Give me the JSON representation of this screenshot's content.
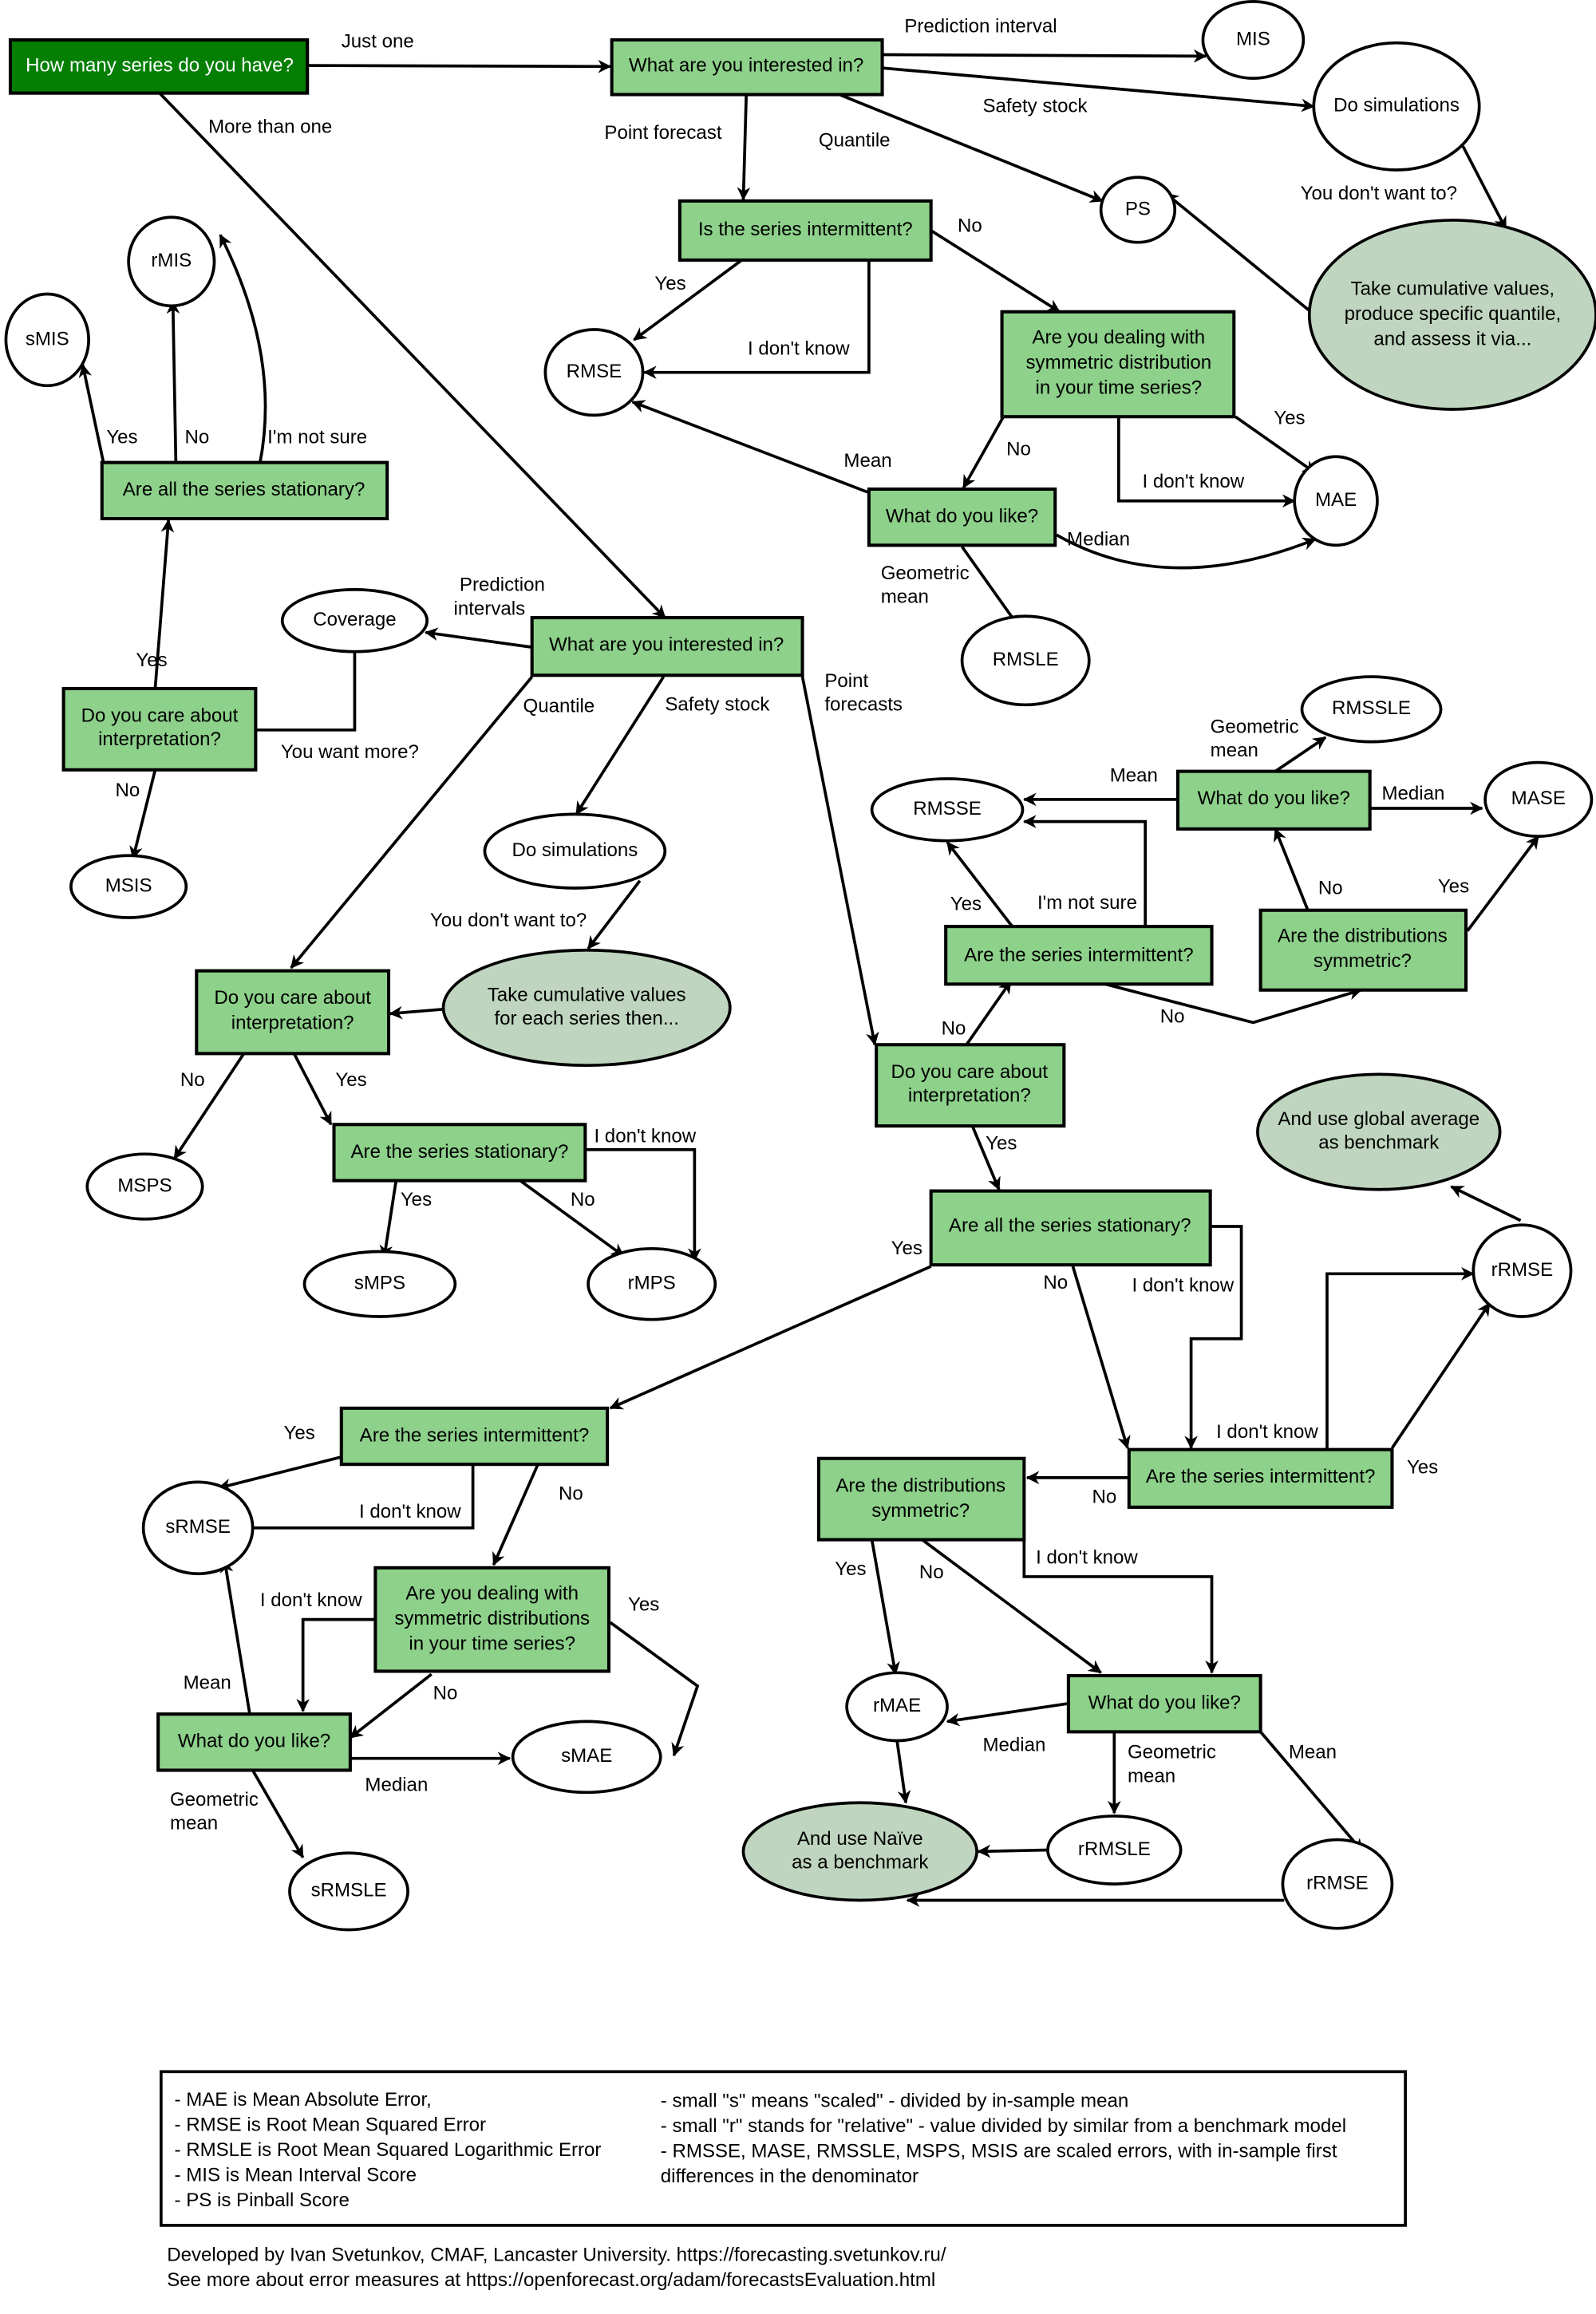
{
  "nodes": {
    "q_how_many": "How many series do you have?",
    "q_interest_one": "What are you interested in?",
    "mis": "MIS",
    "do_sim_one": "Do simulations",
    "ps": "PS",
    "take_cum_one": [
      "Take cumulative values,",
      "produce specific quantile,",
      "and assess it via..."
    ],
    "q_intermittent_one": "Is the series intermittent?",
    "rmse": "RMSE",
    "q_symmetric_one": [
      "Are you dealing with",
      "symmetric distribution",
      "in your time series?"
    ],
    "mae": "MAE",
    "q_like_one": "What do you like?",
    "rmsle": "RMSLE",
    "smis": "sMIS",
    "rmis": "rMIS",
    "q_stationary_pi": "Are all the series stationary?",
    "coverage": "Coverage",
    "q_interest_many": "What are you interested in?",
    "q_care_pi": [
      "Do you care about",
      "interpretation?"
    ],
    "msis": "MSIS",
    "do_sim_many": "Do simulations",
    "take_cum_many": [
      "Take cumulative values",
      "for each series then..."
    ],
    "q_care_q": [
      "Do you care about",
      "interpretation?"
    ],
    "msps": "MSPS",
    "q_stationary_q": "Are the series stationary?",
    "smps": "sMPS",
    "rmps": "rMPS",
    "rmssle": "RMSSLE",
    "rmsse": "RMSSE",
    "q_like_scaled": "What do you like?",
    "mase": "MASE",
    "q_intermittent_pf": "Are the series intermittent?",
    "q_distsym_pf": [
      "Are the distributions",
      "symmetric?"
    ],
    "q_care_pf": [
      "Do you care about",
      "interpretation?"
    ],
    "global_avg": [
      "And use global average",
      "as benchmark"
    ],
    "q_stationary_pf": "Are all the series stationary?",
    "rrmse_top": "rRMSE",
    "q_intermittent_s": "Are the series intermittent?",
    "srmse": "sRMSE",
    "q_symmetric_s": [
      "Are you dealing with",
      "symmetric distributions",
      "in your time series?"
    ],
    "q_like_s": "What do you like?",
    "smae": "sMAE",
    "srmsle": "sRMSLE",
    "q_distsym_r": [
      "Are the distributions",
      "symmetric?"
    ],
    "q_intermittent_r": "Are the series intermittent?",
    "q_like_r": "What do you like?",
    "rmae": "rMAE",
    "naive": [
      "And use Naïve",
      "as a benchmark"
    ],
    "rrmsle": "rRMSLE",
    "rrmse_bottom": "rRMSE"
  },
  "edge_labels": {
    "just_one": "Just one",
    "more_than_one": "More than one",
    "prediction_interval": "Prediction interval",
    "safety_stock_1": "Safety stock",
    "point_forecast": "Point forecast",
    "quantile_1": "Quantile",
    "you_dont_want_1": "You don't want to?",
    "no_1": "No",
    "yes_1": "Yes",
    "idk_1": "I don't know",
    "yes_2": "Yes",
    "no_2": "No",
    "idk_2": "I don't know",
    "mean_1": "Mean",
    "median_1": "Median",
    "geo_1": [
      "Geometric",
      "mean"
    ],
    "yes_smis": "Yes",
    "no_rmis": "No",
    "notsure_rmis": "I'm not sure",
    "pred_intervals": [
      "Prediction",
      "intervals"
    ],
    "yes_care_pi": "Yes",
    "you_want_more": "You want more?",
    "no_msis": "No",
    "quantile_2": "Quantile",
    "safety_stock_2": "Safety stock",
    "point_forecasts": [
      "Point",
      "forecasts"
    ],
    "you_dont_want_2": "You don't want to?",
    "no_msps": "No",
    "yes_care_q": "Yes",
    "idk_rmps": "I don't know",
    "yes_smps": "Yes",
    "no_rmps": "No",
    "geo_2": [
      "Geometric",
      "mean"
    ],
    "mean_2": "Mean",
    "median_2": "Median",
    "yes_rmsse": "Yes",
    "notsure_rmsse": "I'm not sure",
    "no_like2": "No",
    "yes_mase": "Yes",
    "no_int_pf": "No",
    "no_distsym": "No",
    "yes_care_pf": "Yes",
    "yes_stat_pf": "Yes",
    "no_stat_pf": "No",
    "idk_stat_pf": "I don't know",
    "idk_int_r": "I don't know",
    "yes_int_r": "Yes",
    "yes_int_s": "Yes",
    "idk_int_s": "I don't know",
    "no_int_s": "No",
    "idk_sym_s": "I don't know",
    "yes_sym_s": "Yes",
    "mean_s": "Mean",
    "no_sym_s": "No",
    "median_s": "Median",
    "geo_s": [
      "Geometric",
      "mean"
    ],
    "no_int_r": "No",
    "yes_dist_r": "Yes",
    "no_dist_r": "No",
    "idk_dist_r": "I don't know",
    "median_r": "Median",
    "geo_r": [
      "Geometric",
      "mean"
    ],
    "mean_r": "Mean"
  },
  "legend": {
    "left": [
      "- MAE is Mean Absolute Error,",
      "- RMSE is Root Mean Squared Error",
      "- RMSLE is Root Mean Squared Logarithmic Error",
      "- MIS is Mean Interval Score",
      "- PS is Pinball Score"
    ],
    "right": [
      "- small \"s\" means \"scaled\" - divided by in-sample mean",
      "- small \"r\" stands for \"relative\" - value divided by similar from a benchmark model",
      "- RMSSE, MASE, RMSSLE, MSPS, MSIS are scaled errors, with in-sample first",
      "differences in the denominator"
    ]
  },
  "footer": {
    "line1": "Developed by Ivan Svetunkov, CMAF, Lancaster University. https://forecasting.svetunkov.ru/",
    "line2": "See more about error measures at https://openforecast.org/adam/forecastsEvaluation.html"
  },
  "colors": {
    "root_fill": "#047f04",
    "question_fill": "#8dd18a",
    "note_fill": "#bfd5bf",
    "stroke": "#000000"
  }
}
